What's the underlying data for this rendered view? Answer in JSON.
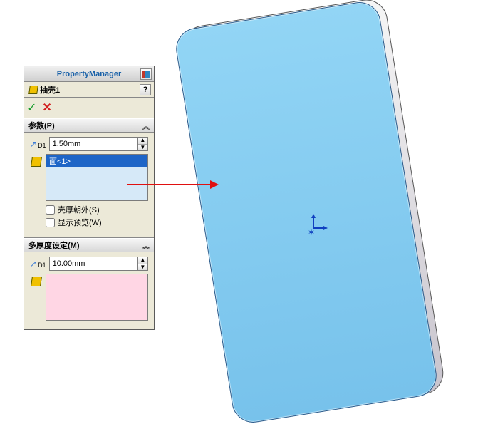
{
  "panel": {
    "title": "PropertyManager",
    "feature_name": "抽壳1",
    "help_label": "?",
    "ok_label": "✓",
    "cancel_label": "✕"
  },
  "params": {
    "head": "参数(P)",
    "d1_label": "D1",
    "thickness": "1.50mm",
    "face_items": [
      "面<1>"
    ],
    "shell_outward_label": "壳厚朝外(S)",
    "shell_outward_checked": false,
    "show_preview_label": "显示预览(W)",
    "show_preview_checked": false
  },
  "multi": {
    "head": "多厚度设定(M)",
    "d1_label": "D1",
    "thickness": "10.00mm"
  },
  "icons": {
    "pin": "📌",
    "chevron_up": "▾",
    "spin_up": "▲",
    "spin_down": "▼"
  }
}
